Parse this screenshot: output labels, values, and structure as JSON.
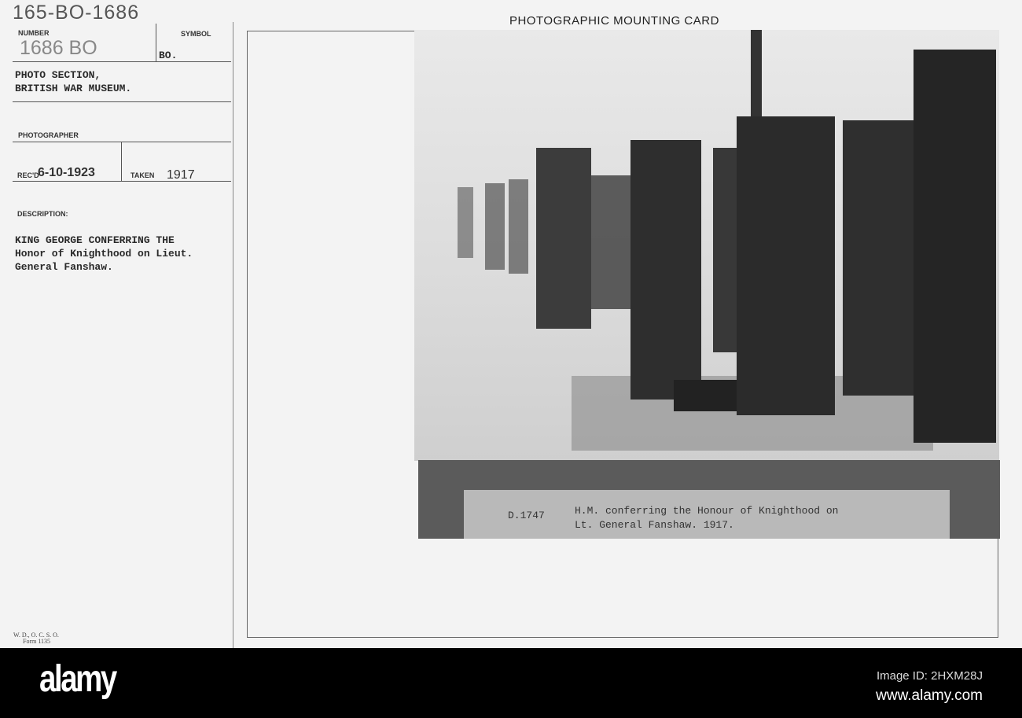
{
  "card": {
    "handwritten_id": "165-BO-1686",
    "number_label": "NUMBER",
    "number_value": "1686 BO",
    "symbol_label": "SYMBOL",
    "symbol_value": "BO.",
    "section_line1": "PHOTO SECTION,",
    "section_line2": "BRITISH WAR MUSEUM.",
    "photographer_label": "PHOTOGRAPHER",
    "recd_label": "REC'D",
    "recd_value": "6-10-1923",
    "taken_label": "TAKEN",
    "taken_value": "1917",
    "description_label": "DESCRIPTION:",
    "description_lines": [
      "KING GEORGE CONFERRING THE",
      "Honor of Knighthood on Lieut.",
      "General Fanshaw."
    ],
    "form_line1": "W. D., O. C. S. O.",
    "form_line2": "Form 1135",
    "mounting_title": "PHOTOGRAPHIC MOUNTING CARD"
  },
  "caption": {
    "code": "D.1747",
    "line1": "H.M. conferring the Honour of Knighthood on",
    "line2": "Lt. General Fanshaw.  1917."
  },
  "footer": {
    "logo": "alamy",
    "image_id": "Image ID: 2HXM28J",
    "url": "www.alamy.com"
  },
  "watermark": "alamy"
}
